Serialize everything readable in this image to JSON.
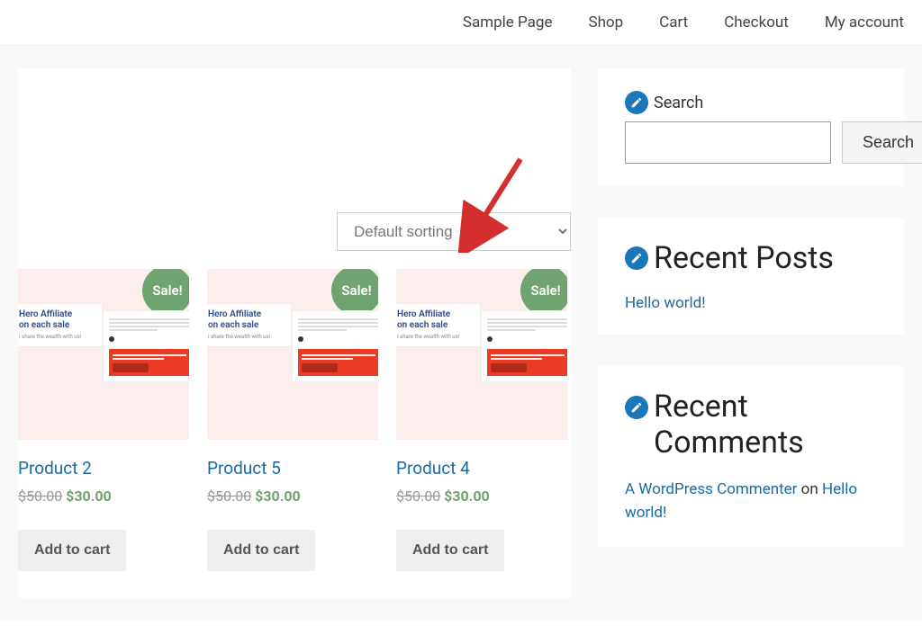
{
  "nav": {
    "items": [
      {
        "label": "Sample Page"
      },
      {
        "label": "Shop"
      },
      {
        "label": "Cart"
      },
      {
        "label": "Checkout"
      },
      {
        "label": "My account"
      }
    ]
  },
  "sorting": {
    "selected": "Default sorting"
  },
  "sale_label": "Sale!",
  "add_to_cart_label": "Add to cart",
  "products": [
    {
      "title": "Product 2",
      "old_price": "$50.00",
      "new_price": "$30.00"
    },
    {
      "title": "Product 5",
      "old_price": "$50.00",
      "new_price": "$30.00"
    },
    {
      "title": "Product 4",
      "old_price": "$50.00",
      "new_price": "$30.00"
    }
  ],
  "sidebar": {
    "search": {
      "label": "Search",
      "button": "Search"
    },
    "recent_posts": {
      "title": "Recent Posts",
      "links": [
        "Hello world!"
      ]
    },
    "recent_comments": {
      "title": "Recent Comments",
      "entries": [
        {
          "author": "A WordPress Commenter",
          "on": " on ",
          "post": "Hello world!"
        }
      ]
    }
  }
}
